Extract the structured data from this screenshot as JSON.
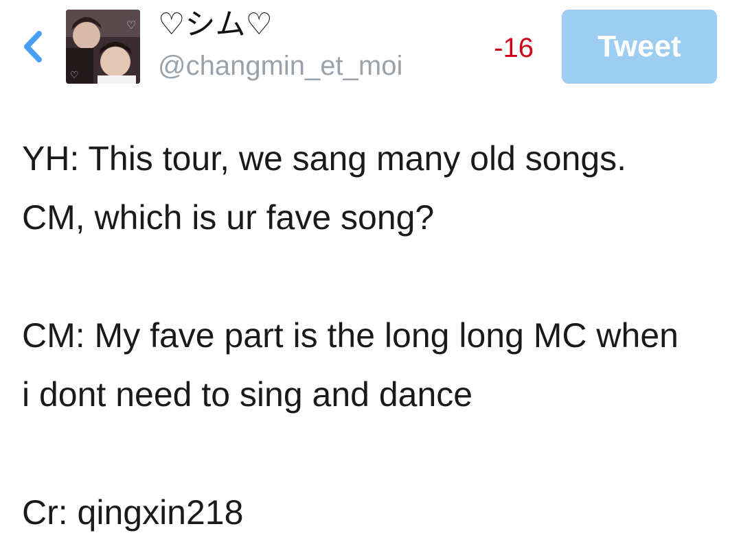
{
  "header": {
    "back_icon": "chevron-left-icon",
    "display_name": "♡シム♡",
    "handle": "@changmin_et_moi",
    "char_count": "-16",
    "tweet_button_label": "Tweet",
    "accent_color": "#1da1f2",
    "tweet_button_color": "#9ecdf2",
    "char_count_color": "#d0021b"
  },
  "composer": {
    "lines": [
      "YH: This tour, we sang many old songs.",
      "CM, which is ur fave song?",
      "",
      "CM: My fave part is the long long MC when",
      "i dont need to sing and dance",
      "",
      "Cr: qingxin218"
    ]
  }
}
